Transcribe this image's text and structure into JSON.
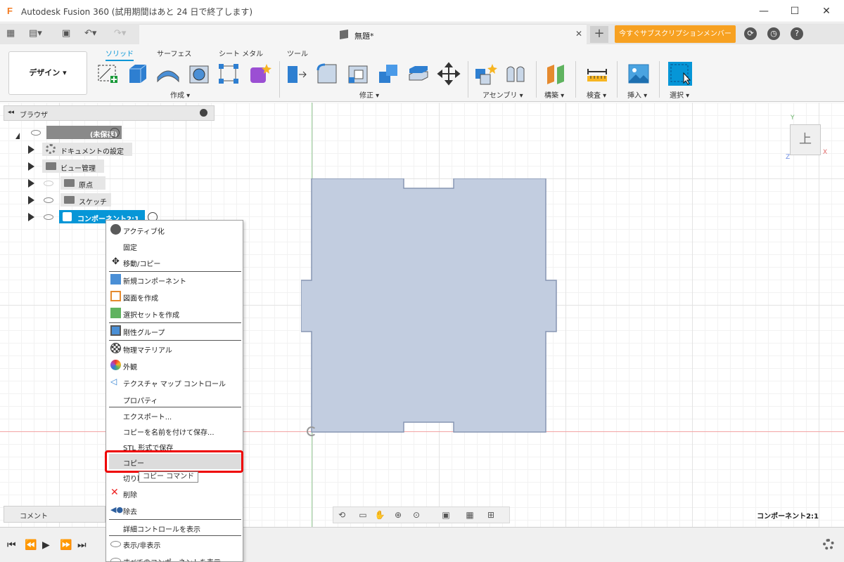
{
  "titlebar": {
    "app_icon": "F",
    "title": "Autodesk Fusion 360 (試用期間はあと 24 日で終了します)",
    "minimize": "—",
    "maximize": "☐",
    "close": "✕"
  },
  "tabbar": {
    "doc_title": "無題*",
    "close": "✕",
    "new_tab": "+",
    "subscribe_label": "今すぐサブスクリプションメンバーに..."
  },
  "ribbon": {
    "workspace": "デザイン ▾",
    "tabs": [
      "ソリッド",
      "サーフェス",
      "シート メタル",
      "ツール"
    ],
    "groups": [
      "作成 ▾",
      "修正 ▾",
      "アセンブリ ▾",
      "構築 ▾",
      "検査 ▾",
      "挿入 ▾",
      "選択 ▾"
    ]
  },
  "browser": {
    "title": "ブラウザ",
    "collapse": "◂◂",
    "root": "(未保存)",
    "items": [
      "ドキュメントの設定",
      "ビュー管理",
      "原点",
      "スケッチ",
      "コンポーネント2:1"
    ]
  },
  "viewcube": {
    "face": "上",
    "x": "X",
    "y": "Y",
    "z": "Z"
  },
  "context_menu": {
    "items": [
      "アクティブ化",
      "固定",
      "移動/コピー",
      "新規コンポーネント",
      "図面を作成",
      "選択セットを作成",
      "剛性グループ",
      "物理マテリアル",
      "外観",
      "テクスチャ マップ コントロール",
      "プロパティ",
      "エクスポート...",
      "コピーを名前を付けて保存...",
      "STL 形式で保存",
      "コピー",
      "切り取り",
      "削除",
      "除去",
      "詳細コントロールを表示",
      "表示/非表示",
      "すべてのコンポーネントを表示"
    ],
    "tooltip": "コピー コマンド"
  },
  "comment": {
    "label": "コメント"
  },
  "status": {
    "component_label": "コンポーネント2:1"
  },
  "colors": {
    "accent": "#0696d7",
    "subscribe": "#f7a121",
    "shape_fill": "#c2cde0",
    "highlight_border": "#ee0000"
  }
}
